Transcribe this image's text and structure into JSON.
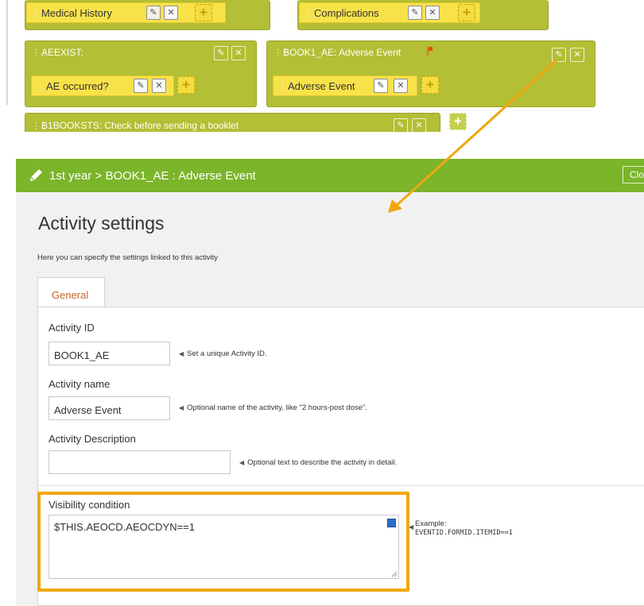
{
  "workflow": {
    "blocks": {
      "aeexist": {
        "header": "AEEXIST:"
      },
      "book1": {
        "header": "BOOK1_AE: Adverse Event"
      },
      "b1booksts": {
        "header": "B1BOOKSTS: Check before sending a booklet"
      }
    },
    "items": {
      "medical_history": "Medical History",
      "complications": "Complications",
      "ae_occurred": "AE occurred?",
      "adverse_event": "Adverse Event"
    },
    "icons": {
      "edit": "pencil-icon",
      "delete": "close-x-icon",
      "add": "plus-icon",
      "flag": "flag-icon"
    }
  },
  "dialog": {
    "breadcrumb": "1st year > BOOK1_AE : Adverse Event",
    "close_label": "Close",
    "heading": "Activity settings",
    "subtitle": "Here you can specify the settings linked to this activity",
    "tab_general": "General",
    "fields": {
      "activity_id": {
        "label": "Activity ID",
        "value": "BOOK1_AE",
        "hint": "Set a unique Activity ID."
      },
      "activity_name": {
        "label": "Activity name",
        "value": "Adverse Event",
        "hint": "Optional name of the activity, like \"2 hours-post dose\"."
      },
      "activity_description": {
        "label": "Activity Description",
        "value": "",
        "hint": "Optional text to describe the activity in detail."
      },
      "visibility_condition": {
        "label": "Visibility condition",
        "value": "$THIS.AEOCD.AEOCDYN==1",
        "example_label": "Example:",
        "example_code": "EVENTID.FORMID.ITEMID==1"
      }
    }
  },
  "colors": {
    "block_green": "#b3bf35",
    "item_yellow": "#f8e24a",
    "bar_green": "#7ab52a",
    "highlight_orange": "#f0a70f",
    "tab_text": "#c9612a"
  }
}
